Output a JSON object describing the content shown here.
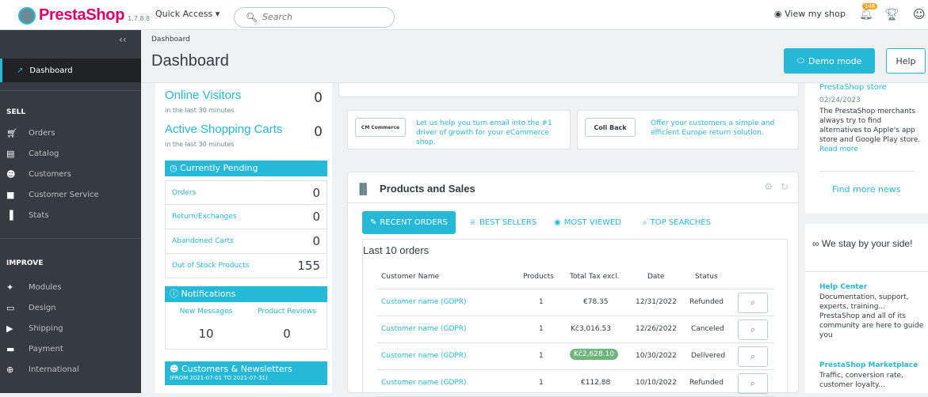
{
  "topbar": {
    "brand": "PrestaShop",
    "version": "1.7.8.8",
    "quick_access": "Quick Access ▾",
    "search_placeholder": "Search",
    "view_shop": "View my shop",
    "notif_count": "146"
  },
  "sidebar": {
    "collapse": "‹‹",
    "dashboard": "Dashboard",
    "sell_header": "SELL",
    "sell_items": [
      "Orders",
      "Catalog",
      "Customers",
      "Customer Service",
      "Stats"
    ],
    "improve_header": "IMPROVE",
    "improve_items": [
      "Modules",
      "Design",
      "Shipping",
      "Payment",
      "International"
    ]
  },
  "header": {
    "breadcrumb": "Dashboard",
    "title": "Dashboard",
    "demo_mode": "Demo mode",
    "help": "Help"
  },
  "activity": {
    "online_visitors_label": "Online Visitors",
    "online_visitors_sub": "in the last 30 minutes",
    "online_visitors_value": "0",
    "carts_label": "Active Shopping Carts",
    "carts_sub": "in the last 30 minutes",
    "carts_value": "0",
    "pending_header": "Currently Pending",
    "pending": [
      {
        "label": "Orders",
        "value": "0"
      },
      {
        "label": "Return/Exchanges",
        "value": "0"
      },
      {
        "label": "Abandoned Carts",
        "value": "0"
      },
      {
        "label": "Out of Stock Products",
        "value": "155"
      }
    ],
    "notifications_header": "Notifications",
    "new_messages_label": "New Messages",
    "new_messages_value": "10",
    "product_reviews_label": "Product Reviews",
    "product_reviews_value": "0",
    "customers_header": "Customers & Newsletters",
    "customers_range": "(FROM 2021-07-01 TO 2021-07-31)"
  },
  "promos": {
    "cm_logo": "CM Commerce",
    "cm_text": "Let us help you turn email into the #1 driver of growth for your eCommerce shop.",
    "coliback_logo": "Coli Back",
    "coliback_text": "Offer your customers a simple and efficient Europe return solution."
  },
  "products_sales": {
    "title": "Products and Sales",
    "tabs": [
      "RECENT ORDERS",
      "BEST SELLERS",
      "MOST VIEWED",
      "TOP SEARCHES"
    ],
    "orders_title": "Last 10 orders",
    "columns": [
      "Customer Name",
      "Products",
      "Total Tax excl.",
      "Date",
      "Status"
    ],
    "rows": [
      {
        "customer": "Customer name (GDPR)",
        "products": "1",
        "total": "€78.35",
        "date": "12/31/2022",
        "status": "Refunded"
      },
      {
        "customer": "Customer name (GDPR)",
        "products": "1",
        "total": "Kč3,016.53",
        "date": "12/26/2022",
        "status": "Canceled"
      },
      {
        "customer": "Customer name (GDPR)",
        "products": "1",
        "total": "Kč2,628.10",
        "date": "10/30/2022",
        "status": "Delivered"
      },
      {
        "customer": "Customer name (GDPR)",
        "products": "1",
        "total": "€112.88",
        "date": "10/10/2022",
        "status": "Refunded"
      }
    ]
  },
  "news": {
    "top": "PrestaShop store",
    "date": "02/24/2023",
    "body": "The PrestaShop merchants always try to find alternatives to Apple's app store and Google Play store.",
    "read_more": "Read more",
    "find_more": "Find more news"
  },
  "support": {
    "title": "We stay by your side!",
    "help_center_title": "Help Center",
    "help_center_text": "Documentation, support, experts, training... PrestaShop and all of its community are here to guide you",
    "marketplace_title": "PrestaShop Marketplace",
    "marketplace_text": "Traffic, conversion rate, customer loyalty..."
  },
  "colors": {
    "accent": "#25b9d7",
    "brand": "#df0067",
    "sidebar": "#363a41",
    "success": "#70b580"
  }
}
